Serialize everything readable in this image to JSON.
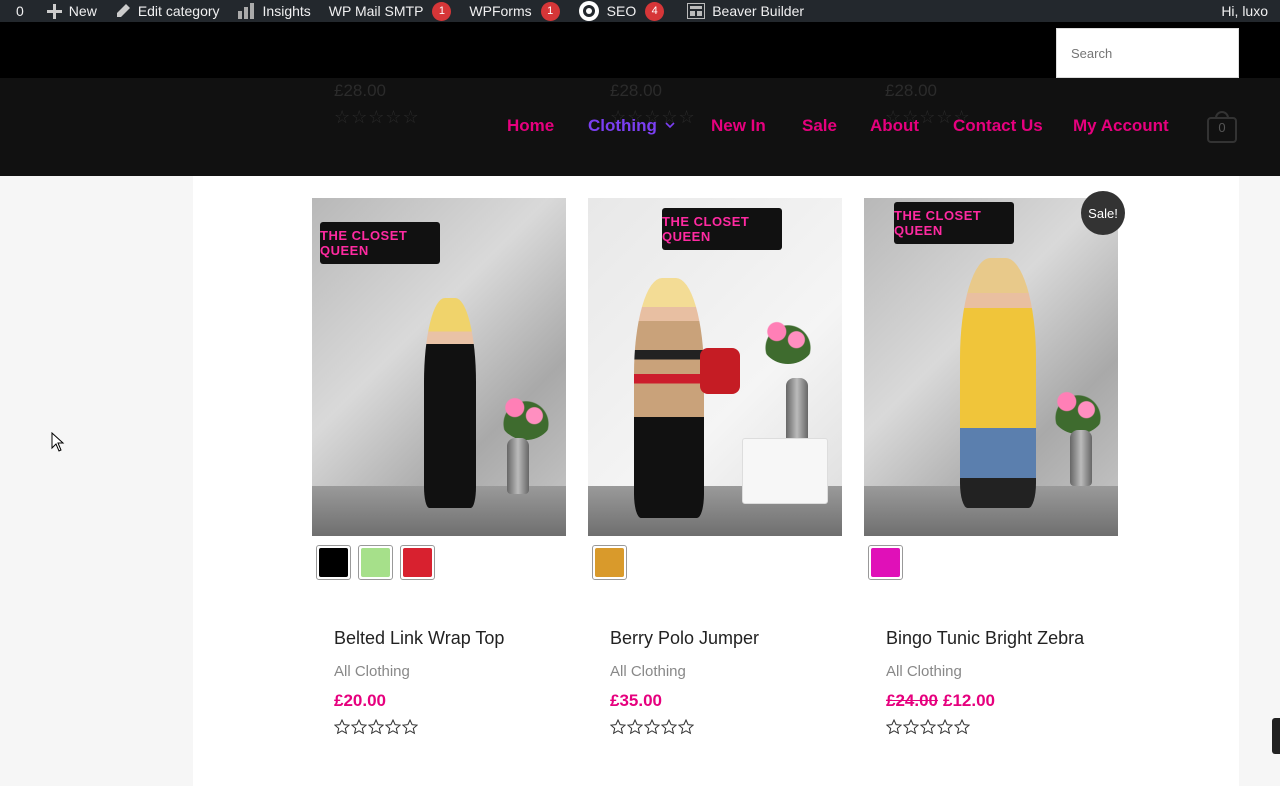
{
  "adminbar": {
    "counter": "0",
    "new_label": "New",
    "edit_label": "Edit category",
    "insights_label": "Insights",
    "wpmail_label": "WP Mail SMTP",
    "wpmail_count": "1",
    "wpforms_label": "WPForms",
    "wpforms_count": "1",
    "seo_label": "SEO",
    "seo_count": "4",
    "beaver_label": "Beaver Builder",
    "greeting": "Hi, luxo"
  },
  "search": {
    "placeholder": "Search"
  },
  "nav": {
    "items": [
      {
        "label": "Home"
      },
      {
        "label": "Clothing"
      },
      {
        "label": "New In"
      },
      {
        "label": "Sale"
      },
      {
        "label": "About"
      },
      {
        "label": "Contact Us"
      },
      {
        "label": "My Account"
      }
    ],
    "cart_count": "0"
  },
  "ghost_prices": [
    "£28.00",
    "£28.00",
    "£28.00"
  ],
  "products": [
    {
      "title": "Belted Link Wrap Top",
      "category": "All Clothing",
      "price": "£20.00",
      "old_price": "",
      "sign_text": "THE CLOSET QUEEN",
      "swatches": [
        "#000000",
        "#a6e08a",
        "#d8212f"
      ]
    },
    {
      "title": "Berry Polo Jumper",
      "category": "All Clothing",
      "price": "£35.00",
      "old_price": "",
      "sign_text": "THE CLOSET QUEEN",
      "swatches": [
        "#d99a2b"
      ]
    },
    {
      "title": "Bingo Tunic Bright Zebra",
      "category": "All Clothing",
      "price": "£12.00",
      "old_price": "£24.00",
      "sign_text": "THE CLOSET QUEEN",
      "swatches": [
        "#e010b8"
      ]
    }
  ],
  "sale_badge": "Sale!",
  "colors": {
    "accent": "#e6007e",
    "nav_active": "#7b3ff2",
    "header_bg": "#111111"
  }
}
